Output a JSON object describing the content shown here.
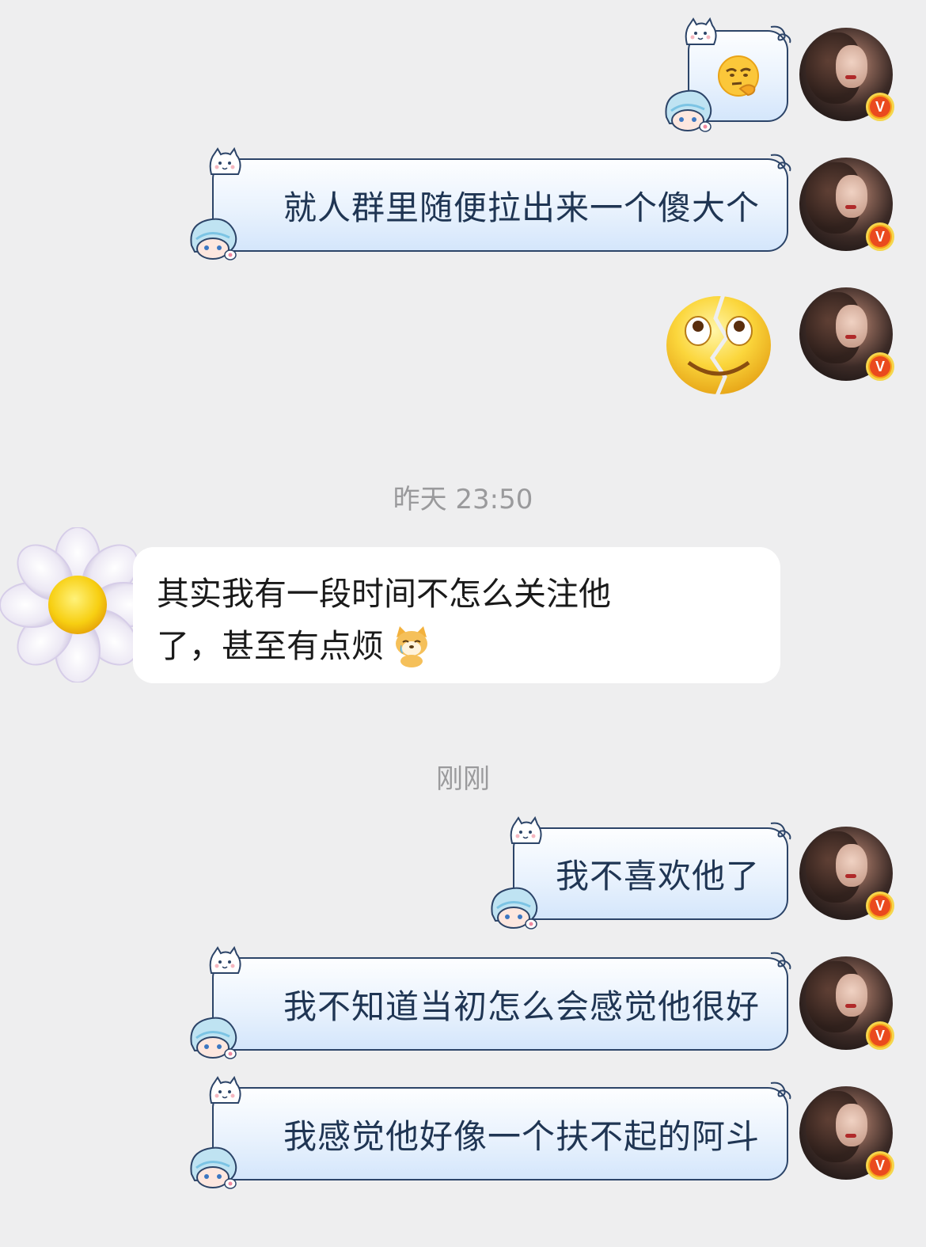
{
  "colors": {
    "background": "#eeeeef",
    "bubble_border": "#2c4468",
    "bubble_text": "#1f3553",
    "incoming_bubble": "#ffffff",
    "timestamp_text": "#9a9a9c",
    "vip_badge": "#ea4a1e"
  },
  "avatar_badge": "V",
  "timestamps": {
    "yesterday": "昨天 23:50",
    "just_now": "刚刚"
  },
  "messages": [
    {
      "side": "right",
      "type": "emoji",
      "icon": "thinking-face-icon"
    },
    {
      "side": "right",
      "type": "text",
      "text": "就人群里随便拉出来一个傻大个"
    },
    {
      "side": "right",
      "type": "emoji",
      "icon": "broken-face-emoji-icon"
    },
    {
      "side": "left",
      "type": "text",
      "lines": [
        "其实我有一段时间不怎么关注他",
        "了，甚至有点烦"
      ],
      "icon": "crying-dog-emoji-icon"
    },
    {
      "side": "right",
      "type": "text",
      "text": "我不喜欢他了"
    },
    {
      "side": "right",
      "type": "text",
      "text": "我不知道当初怎么会感觉他很好"
    },
    {
      "side": "right",
      "type": "text",
      "text": "我感觉他好像一个扶不起的阿斗"
    }
  ]
}
